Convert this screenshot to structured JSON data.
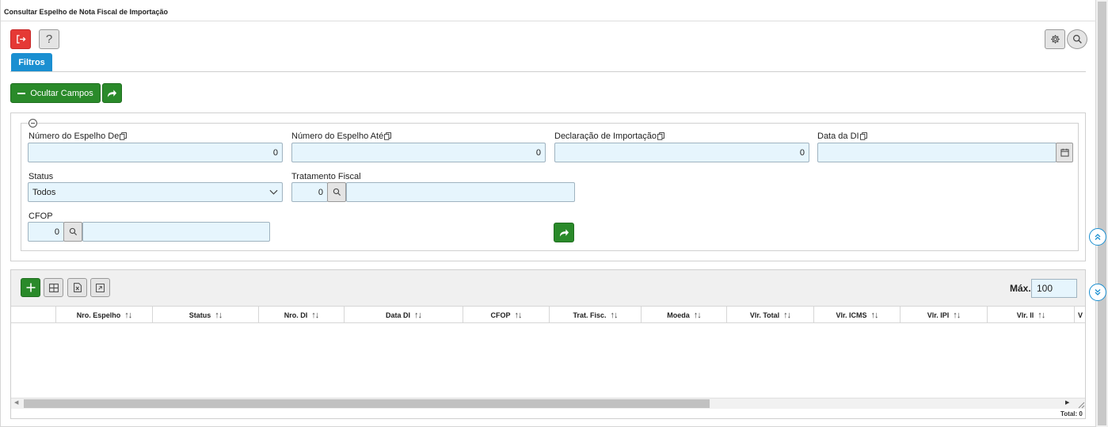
{
  "window": {
    "title": "Consultar Espelho de Nota Fiscal de Importação"
  },
  "toolbar": {
    "exit_icon": "exit-icon",
    "help_label": "?",
    "settings_icon": "gear-icon",
    "search_icon": "search-icon"
  },
  "tabs": [
    {
      "label": "Filtros",
      "active": true
    }
  ],
  "actions": {
    "hide_fields_label": "Ocultar Campos"
  },
  "filters": {
    "numero_espelho_de": {
      "label": "Número do Espelho De",
      "value": "0"
    },
    "numero_espelho_ate": {
      "label": "Número do Espelho Até",
      "value": "0"
    },
    "declaracao_importacao": {
      "label": "Declaração de Importação",
      "value": "0"
    },
    "data_di": {
      "label": "Data da DI",
      "value": ""
    },
    "status": {
      "label": "Status",
      "value": "Todos"
    },
    "tratamento_fiscal": {
      "label": "Tratamento Fiscal",
      "code": "0",
      "description": ""
    },
    "cfop": {
      "label": "CFOP",
      "code": "0",
      "description": ""
    }
  },
  "grid": {
    "max_label": "Máx.",
    "max_value": "100",
    "columns": [
      "Nro. Espelho",
      "Status",
      "Nro. DI",
      "Data DI",
      "CFOP",
      "Trat. Fisc.",
      "Moeda",
      "Vlr. Total",
      "Vlr. ICMS",
      "Vlr. IPI",
      "Vlr. II",
      "V"
    ],
    "total_label": "Total: 0"
  },
  "colors": {
    "primary_blue": "#1a8fd1",
    "action_green": "#2a8a2a",
    "danger_red": "#e53935",
    "input_bg": "#e6f5fd"
  }
}
